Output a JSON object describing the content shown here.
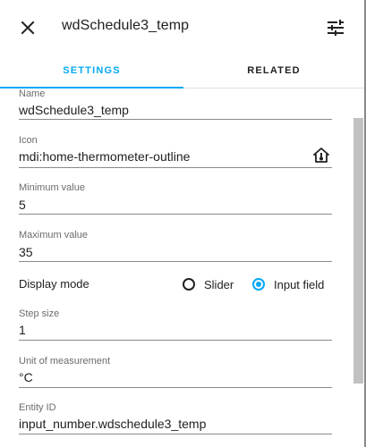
{
  "header": {
    "title": "wdSchedule3_temp",
    "close_icon": "close-icon",
    "settings_icon": "tune-icon"
  },
  "tabs": [
    {
      "label": "SETTINGS",
      "active": true
    },
    {
      "label": "RELATED",
      "active": false
    }
  ],
  "fields": {
    "name": {
      "label": "Name",
      "value": "wdSchedule3_temp"
    },
    "icon": {
      "label": "Icon",
      "value": "mdi:home-thermometer-outline",
      "trailing_icon": "home-thermometer-outline-icon"
    },
    "minimum": {
      "label": "Minimum value",
      "value": "5"
    },
    "maximum": {
      "label": "Maximum value",
      "value": "35"
    },
    "step": {
      "label": "Step size",
      "value": "1"
    },
    "unit": {
      "label": "Unit of measurement",
      "value": "°C"
    },
    "entity_id": {
      "label": "Entity ID",
      "value": "input_number.wdschedule3_temp"
    }
  },
  "display_mode": {
    "label": "Display mode",
    "options": [
      {
        "label": "Slider",
        "checked": false
      },
      {
        "label": "Input field",
        "checked": true
      }
    ]
  },
  "colors": {
    "accent": "#03a9f4",
    "text": "#212121",
    "secondary_text": "#6b6b6b",
    "backdrop": "#6f6f6f"
  }
}
